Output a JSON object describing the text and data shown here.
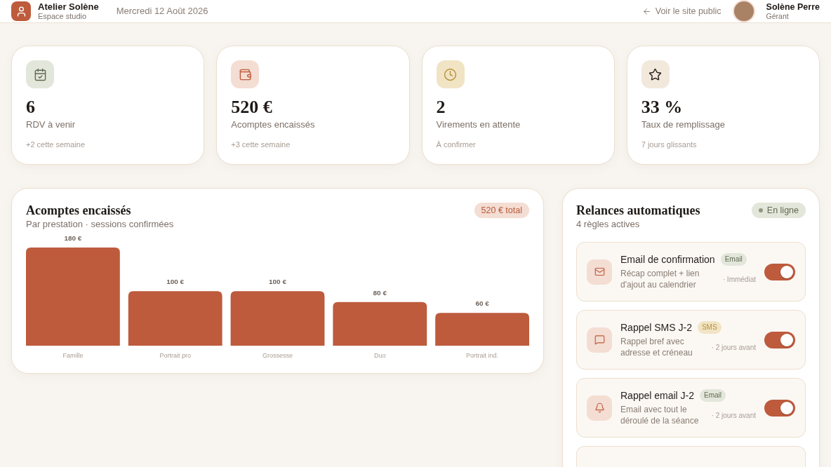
{
  "header": {
    "brand": {
      "title": "Atelier Solène",
      "subtitle": "Espace studio"
    },
    "date": "Mercredi 12 Août 2026",
    "public_link": "Voir le site public",
    "user": {
      "name": "Solène Perre",
      "role": "Gérant"
    }
  },
  "stats": [
    {
      "value": "6",
      "label": "RDV à venir",
      "note": "+2 cette semaine"
    },
    {
      "value": "520 €",
      "label": "Acomptes encaissés",
      "note": "+3 cette semaine"
    },
    {
      "value": "2",
      "label": "Virements en attente",
      "note": "À confirmer"
    },
    {
      "value": "33 %",
      "label": "Taux de remplissage",
      "note": "7 jours glissants"
    }
  ],
  "deposits": {
    "title": "Acomptes encaissés",
    "subtitle": "Par prestation · sessions confirmées",
    "badge": "520 € total",
    "chart_data": {
      "type": "bar",
      "categories": [
        "Famille",
        "Portrait pro",
        "Grossesse",
        "Duo",
        "Portrait ind."
      ],
      "values": [
        180,
        100,
        100,
        80,
        60
      ],
      "value_labels": [
        "180 €",
        "100 €",
        "100 €",
        "80 €",
        "60 €"
      ]
    }
  },
  "reminders": {
    "title": "Relances automatiques",
    "status": "En ligne",
    "subtitle": "4 règles actives",
    "rules": [
      {
        "title": "Email de confirmation",
        "tag": {
          "label": "Email",
          "kind": "email"
        },
        "description": "Récap complet + lien d'ajout au calendrier",
        "timing": "· Immédiat",
        "on": true
      },
      {
        "title": "Rappel SMS J-2",
        "tag": {
          "label": "SMS",
          "kind": "sms"
        },
        "description": "Rappel bref avec adresse et créneau",
        "timing": "· 2 jours avant",
        "on": true
      },
      {
        "title": "Rappel email J-2",
        "tag": {
          "label": "Email",
          "kind": "email"
        },
        "description": "Email avec tout le déroulé de la séance",
        "timing": "· 2 jours avant",
        "on": true
      }
    ]
  }
}
